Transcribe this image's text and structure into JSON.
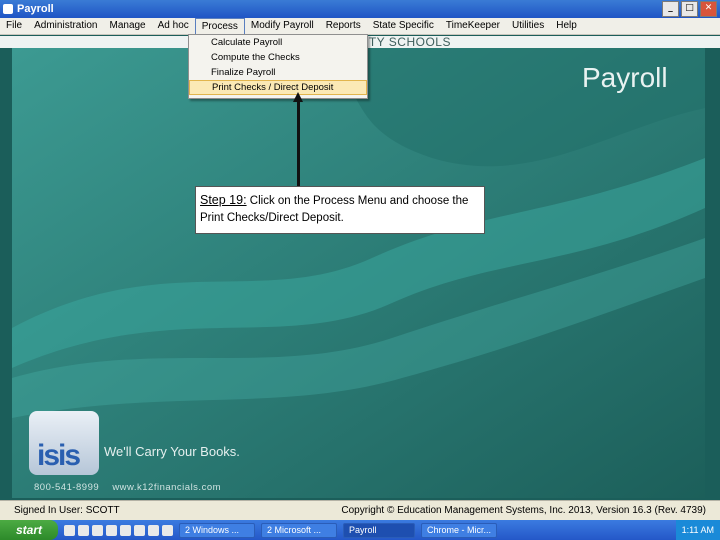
{
  "window": {
    "title": "Payroll"
  },
  "menu": [
    {
      "label": "File"
    },
    {
      "label": "Administration"
    },
    {
      "label": "Manage"
    },
    {
      "label": "Ad hoc"
    },
    {
      "label": "Process"
    },
    {
      "label": "Modify Payroll"
    },
    {
      "label": "Reports"
    },
    {
      "label": "State Specific"
    },
    {
      "label": "TimeKeeper"
    },
    {
      "label": "Utilities"
    },
    {
      "label": "Help"
    }
  ],
  "process_menu": {
    "items": [
      {
        "label": "Calculate Payroll"
      },
      {
        "label": "Compute the Checks"
      },
      {
        "label": "Finalize Payroll"
      },
      {
        "label": "Print Checks / Direct Deposit"
      }
    ]
  },
  "header": {
    "district": "ITY SCHOOLS"
  },
  "brand": {
    "module": "Payroll",
    "logo_text": "isis",
    "tagline": "We'll Carry Your Books.",
    "phone": "800-541-8999",
    "website": "www.k12financials.com"
  },
  "callout": {
    "step": "Step 19:",
    "text": "Click on the Process Menu and choose the Print Checks/Direct Deposit."
  },
  "status": {
    "signed_in": "Signed In User: SCOTT",
    "copyright": "Copyright © Education Management Systems, Inc. 2013, Version 16.3 (Rev. 4739)"
  },
  "taskbar": {
    "start": "start",
    "tasks": [
      {
        "label": "2 Windows ..."
      },
      {
        "label": "2 Microsoft ..."
      },
      {
        "label": "Payroll"
      },
      {
        "label": "Chrome - Micr..."
      }
    ],
    "clock": "1:11 AM"
  },
  "colors": {
    "teal": "#2a8079",
    "highlight": "#fbe9b5",
    "titlebar": "#1f55c5"
  }
}
